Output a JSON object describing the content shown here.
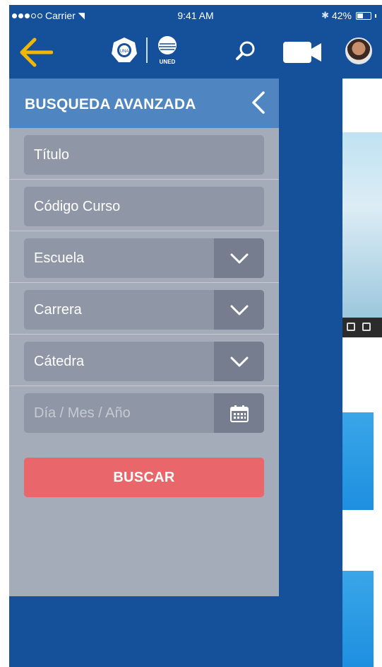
{
  "status_bar": {
    "carrier": "Carrier",
    "time": "9:41 AM",
    "battery": "42%",
    "battery_level": 0.42
  },
  "header": {
    "back_icon": "arrow-left-icon",
    "logo_1": "una-logo",
    "logo_2": "uned-logo",
    "logo_2_text": "UNED",
    "search_icon": "search-icon",
    "video_icon": "video-camera-icon",
    "avatar": "user-avatar"
  },
  "drawer": {
    "title": "BUSQUEDA AVANZADA",
    "close_icon": "chevron-left-icon",
    "fields": {
      "titulo": {
        "placeholder": "Título"
      },
      "codigo": {
        "placeholder": "Código Curso"
      },
      "escuela": {
        "value": "Escuela"
      },
      "carrera": {
        "value": "Carrera"
      },
      "catedra": {
        "value": "Cátedra"
      },
      "fecha": {
        "placeholder": "Día / Mes / Año"
      }
    },
    "submit_label": "BUSCAR"
  },
  "colors": {
    "primary": "#15509a",
    "drawer_header": "#4f86c1",
    "drawer_bg": "#a4abb9",
    "field_bg": "#8f96a5",
    "field_button": "#757d8f",
    "submit": "#e9676a",
    "back_arrow": "#f2b705"
  }
}
